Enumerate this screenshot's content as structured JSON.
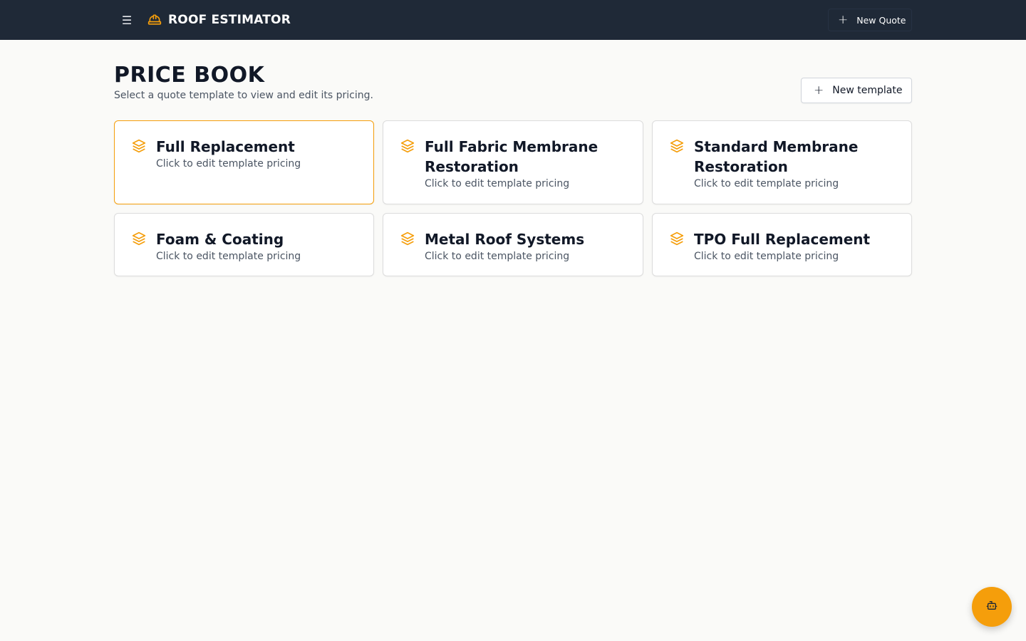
{
  "header": {
    "menu_icon": "hamburger-icon",
    "brand_icon": "hard-hat-icon",
    "title": "ROOF ESTIMATOR",
    "new_quote_label": "New Quote"
  },
  "page": {
    "title": "PRICE BOOK",
    "subtitle": "Select a quote template to view and edit its pricing.",
    "new_template_label": "New template"
  },
  "templates": [
    {
      "title": "Full Replacement",
      "description": "Click to edit template pricing",
      "icon": "layers-icon"
    },
    {
      "title": "Full Fabric Membrane Restoration",
      "description": "Click to edit template pricing",
      "icon": "layers-icon"
    },
    {
      "title": "Standard Membrane Restoration",
      "description": "Click to edit template pricing",
      "icon": "layers-icon"
    },
    {
      "title": "Foam & Coating",
      "description": "Click to edit template pricing",
      "icon": "layers-icon"
    },
    {
      "title": "Metal Roof Systems",
      "description": "Click to edit template pricing",
      "icon": "layers-icon"
    },
    {
      "title": "TPO Full Replacement",
      "description": "Click to edit template pricing",
      "icon": "layers-icon"
    }
  ],
  "fab_icon": "bot-icon",
  "colors": {
    "header_bg": "#1f2937",
    "accent": "#f59e0b",
    "page_bg": "#fafaf8"
  }
}
